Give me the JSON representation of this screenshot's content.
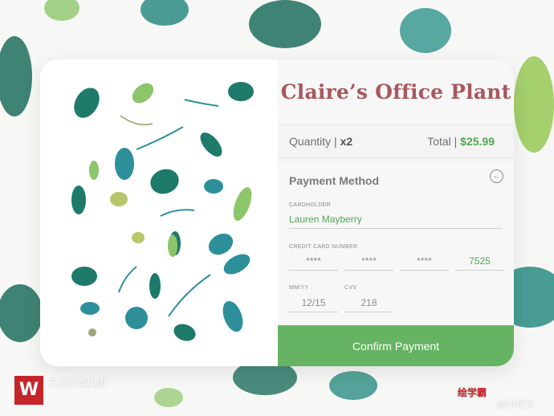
{
  "product": {
    "title": "Claire’s Office Plant",
    "quantity_label": "Quantity",
    "quantity_value": "x2",
    "total_label": "Total",
    "total_value": "$25.99"
  },
  "payment": {
    "heading": "Payment Method",
    "back_icon": "arrow-left-circle-icon",
    "cardholder_label": "CARDHOLDER",
    "cardholder_value": "Lauren Mayberry",
    "card_number_label": "CREDIT CARD NUMBER",
    "card_groups": [
      "****",
      "****",
      "****",
      "7525"
    ],
    "expiry_label": "MM/YY",
    "expiry_value": "12/15",
    "cvv_label": "CVV",
    "cvv_value": "218",
    "confirm_label": "Confirm Payment"
  },
  "watermark": {
    "logo_letter": "W",
    "left_text": "王氏教育集团",
    "right_text": "绘学霸",
    "credit_text": "@UI设计"
  },
  "colors": {
    "title": "#a8585e",
    "accent": "#65b363",
    "price": "#4fa84f",
    "leaf_dark": "#1e7a6b",
    "leaf_light": "#8cc56a"
  }
}
